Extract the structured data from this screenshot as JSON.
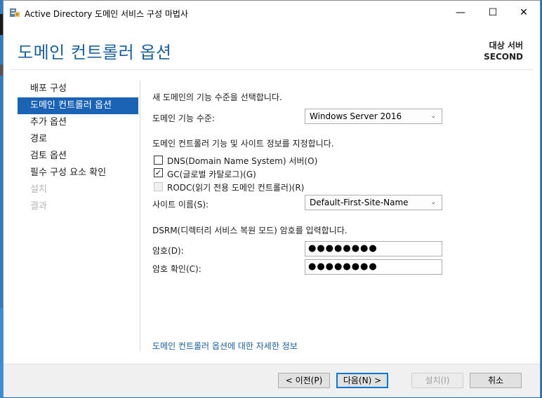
{
  "window": {
    "title": "Active Directory 도메인 서비스 구성 마법사",
    "minimize": "—",
    "maximize": "☐",
    "close": "✕"
  },
  "header": {
    "title": "도메인 컨트롤러 옵션",
    "target_label": "대상 서버",
    "target_name": "SECOND"
  },
  "nav": {
    "items": [
      {
        "label": "배포 구성"
      },
      {
        "label": "도메인 컨트롤러 옵션"
      },
      {
        "label": "추가 옵션"
      },
      {
        "label": "경로"
      },
      {
        "label": "검토 옵션"
      },
      {
        "label": "필수 구성 요소 확인"
      },
      {
        "label": "설치"
      },
      {
        "label": "결과"
      }
    ]
  },
  "content": {
    "section1": "새 도메인의 기능 수준을 선택합니다.",
    "domain_level_label": "도메인 기능 수준:",
    "domain_level_value": "Windows Server 2016",
    "section2": "도메인 컨트롤러 기능 및 사이트 정보를 지정합니다.",
    "dns_label": "DNS(Domain Name System) 서버(O)",
    "gc_label": "GC(글로벌 카탈로그)(G)",
    "gc_check": "✓",
    "rodc_label": "RODC(읽기 전용 도메인 컨트롤러)(R)",
    "site_label": "사이트 이름(S):",
    "site_value": "Default-First-Site-Name",
    "section3": "DSRM(디렉터리 서비스 복원 모드) 암호를 입력합니다.",
    "password_label": "암호(D):",
    "password_value": "●●●●●●●●",
    "confirm_label": "암호 확인(C):",
    "confirm_value": "●●●●●●●●",
    "more_info": "도메인 컨트롤러 옵션에 대한 자세한 정보"
  },
  "footer": {
    "prev": "< 이전(P)",
    "next": "다음(N) >",
    "install": "설치(I)",
    "cancel": "취소"
  }
}
